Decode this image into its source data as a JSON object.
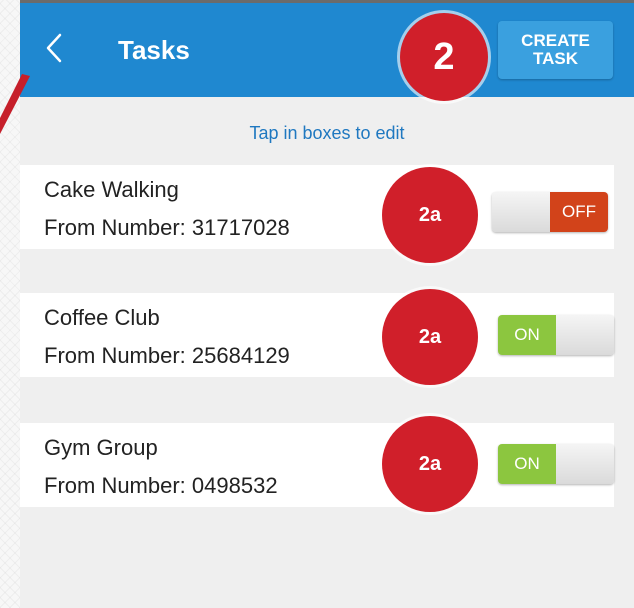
{
  "header": {
    "title": "Tasks",
    "create_label": "CREATE\nTASK"
  },
  "hint": "Tap in boxes to edit",
  "tasks": [
    {
      "name": "Cake Walking",
      "number_label": "From Number: 31717028",
      "state": "OFF"
    },
    {
      "name": "Coffee Club",
      "number_label": "From Number: 25684129",
      "state": "ON"
    },
    {
      "name": "Gym Group",
      "number_label": "From Number: 0498532",
      "state": "ON"
    }
  ],
  "annotations": {
    "step_main": "2",
    "step_sub": [
      "2a",
      "2a",
      "2a"
    ]
  },
  "colors": {
    "header_bg": "#1f88d0",
    "toggle_on": "#8cc63f",
    "toggle_off": "#d2431a",
    "badge": "#d01f2a",
    "hint_text": "#1f78c0"
  },
  "icons": {
    "back": "back-chevron-icon",
    "pointer": "annotation-arrow-icon"
  }
}
